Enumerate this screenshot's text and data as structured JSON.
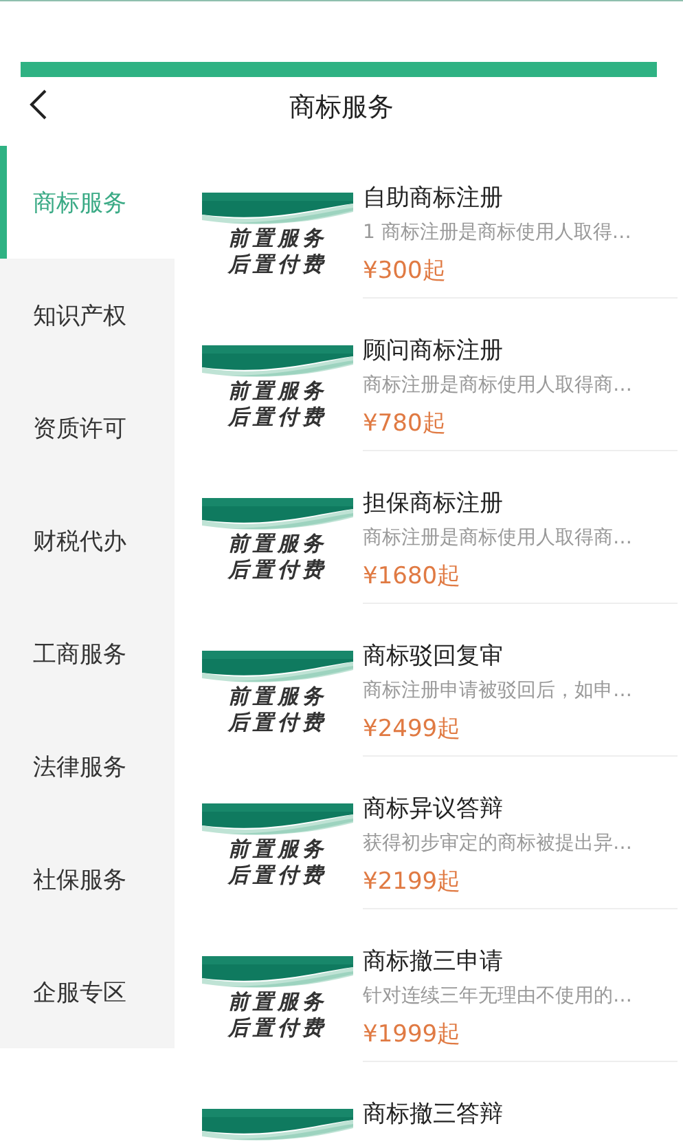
{
  "header": {
    "title": "商标服务"
  },
  "sidebar": {
    "items": [
      {
        "label": "商标服务",
        "selected": true
      },
      {
        "label": "知识产权",
        "selected": false
      },
      {
        "label": "资质许可",
        "selected": false
      },
      {
        "label": "财税代办",
        "selected": false
      },
      {
        "label": "工商服务",
        "selected": false
      },
      {
        "label": "法律服务",
        "selected": false
      },
      {
        "label": "社保服务",
        "selected": false
      },
      {
        "label": "企服专区",
        "selected": false
      }
    ]
  },
  "services": [
    {
      "title": "自助商标注册",
      "description": "1 商标注册是商标使用人取得…",
      "price": "¥300起",
      "banner_lines": [
        "前置服务",
        "后置付费"
      ]
    },
    {
      "title": "顾问商标注册",
      "description": "商标注册是商标使用人取得商…",
      "price": "¥780起",
      "banner_lines": [
        "前置服务",
        "后置付费"
      ]
    },
    {
      "title": "担保商标注册",
      "description": "商标注册是商标使用人取得商…",
      "price": "¥1680起",
      "banner_lines": [
        "前置服务",
        "后置付费"
      ]
    },
    {
      "title": "商标驳回复审",
      "description": "商标注册申请被驳回后，如申…",
      "price": "¥2499起",
      "banner_lines": [
        "前置服务",
        "后置付费"
      ]
    },
    {
      "title": "商标异议答辩",
      "description": "获得初步审定的商标被提出异…",
      "price": "¥2199起",
      "banner_lines": [
        "前置服务",
        "后置付费"
      ]
    },
    {
      "title": "商标撤三申请",
      "description": "针对连续三年无理由不使用的…",
      "price": "¥1999起",
      "banner_lines": [
        "前置服务",
        "后置付费"
      ]
    },
    {
      "title": "商标撤三答辩"
    }
  ]
}
